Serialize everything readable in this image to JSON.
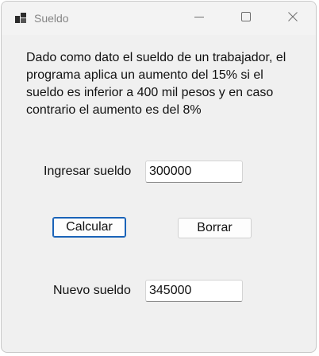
{
  "window": {
    "title": "Sueldo",
    "icons": {
      "app": "app-icon",
      "minimize": "minimize-icon",
      "maximize": "maximize-icon",
      "close": "close-icon"
    }
  },
  "form": {
    "description": "Dado como dato el sueldo de un trabajador, el programa aplica un aumento del 15% si el sueldo es inferior a 400 mil pesos y en caso contrario el aumento es del 8%",
    "input_label": "Ingresar sueldo",
    "input_value": "300000",
    "calculate_label": "Calcular",
    "clear_label": "Borrar",
    "output_label": "Nuevo sueldo",
    "output_value": "345000"
  },
  "colors": {
    "accent": "#1a63b8",
    "window_bg": "#f0f0f0"
  }
}
